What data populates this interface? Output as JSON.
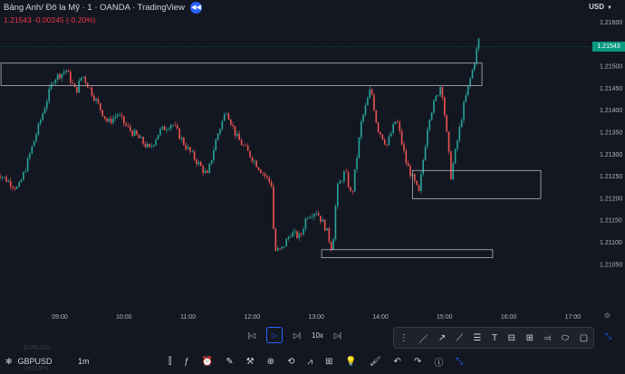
{
  "header": {
    "title": "Bảng Anh/ Đô la Mỹ · 1 · OANDA · TradingView",
    "price_line": "1.21543  -0.00245 (-0.20%)"
  },
  "currency": "USD",
  "price_axis": {
    "ticks": [
      "1.21600",
      "1.21550",
      "1.21500",
      "1.21450",
      "1.21400",
      "1.21350",
      "1.21300",
      "1.21250",
      "1.21200",
      "1.21150",
      "1.21100",
      "1.21050"
    ],
    "current_price": "1.21543"
  },
  "time_axis": {
    "ticks": [
      "09:00",
      "10:00",
      "11:00",
      "12:00",
      "13:00",
      "14:00",
      "15:00",
      "16:00",
      "17:00"
    ]
  },
  "chart_data": {
    "type": "candlestick",
    "x_start": "08:00",
    "x_end": "16:20",
    "ylim": [
      1.21025,
      1.21625
    ],
    "price_path": [
      [
        0,
        1.2126
      ],
      [
        0.35,
        1.2122
      ],
      [
        0.45,
        1.2126
      ],
      [
        0.9,
        1.2147
      ],
      [
        1.1,
        1.2149
      ],
      [
        1.25,
        1.2144
      ],
      [
        1.35,
        1.2148
      ],
      [
        1.75,
        1.2137
      ],
      [
        1.9,
        1.2139
      ],
      [
        2.05,
        1.2136
      ],
      [
        2.2,
        1.2134
      ],
      [
        2.4,
        1.2131
      ],
      [
        2.55,
        1.2135
      ],
      [
        2.75,
        1.2137
      ],
      [
        2.95,
        1.2132
      ],
      [
        3.1,
        1.2129
      ],
      [
        3.3,
        1.2125
      ],
      [
        3.45,
        1.2134
      ],
      [
        3.6,
        1.214
      ],
      [
        3.75,
        1.2134
      ],
      [
        3.9,
        1.2131
      ],
      [
        4.1,
        1.2127
      ],
      [
        4.3,
        1.2123
      ],
      [
        4.35,
        1.2108
      ],
      [
        4.45,
        1.2108
      ],
      [
        4.6,
        1.2112
      ],
      [
        4.75,
        1.2111
      ],
      [
        4.85,
        1.2116
      ],
      [
        5.0,
        1.2117
      ],
      [
        5.15,
        1.2113
      ],
      [
        5.25,
        1.2108
      ],
      [
        5.32,
        1.2122
      ],
      [
        5.45,
        1.2126
      ],
      [
        5.55,
        1.212
      ],
      [
        5.7,
        1.2137
      ],
      [
        5.85,
        1.2145
      ],
      [
        5.95,
        1.2136
      ],
      [
        6.1,
        1.2132
      ],
      [
        6.25,
        1.2138
      ],
      [
        6.4,
        1.2128
      ],
      [
        6.6,
        1.2121
      ],
      [
        6.75,
        1.2138
      ],
      [
        6.95,
        1.2146
      ],
      [
        7.1,
        1.2125
      ],
      [
        7.2,
        1.2133
      ],
      [
        7.3,
        1.2141
      ],
      [
        7.45,
        1.215
      ],
      [
        7.55,
        1.2157
      ]
    ],
    "zones": [
      {
        "x_from": "08:05",
        "x_to": "15:35",
        "y_low": 1.21455,
        "y_high": 1.21506
      },
      {
        "x_from": "13:05",
        "x_to": "15:45",
        "y_low": 1.21064,
        "y_high": 1.21082
      },
      {
        "x_from": "14:30",
        "x_to": "16:30",
        "y_low": 1.21198,
        "y_high": 1.21262
      }
    ]
  },
  "playback": {
    "speed": "10x"
  },
  "bottom_bar": {
    "symbol": "GBPUSD",
    "interval": "1m",
    "ghost_top": "EURUSD",
    "ghost_bottom": "USDJPY"
  }
}
